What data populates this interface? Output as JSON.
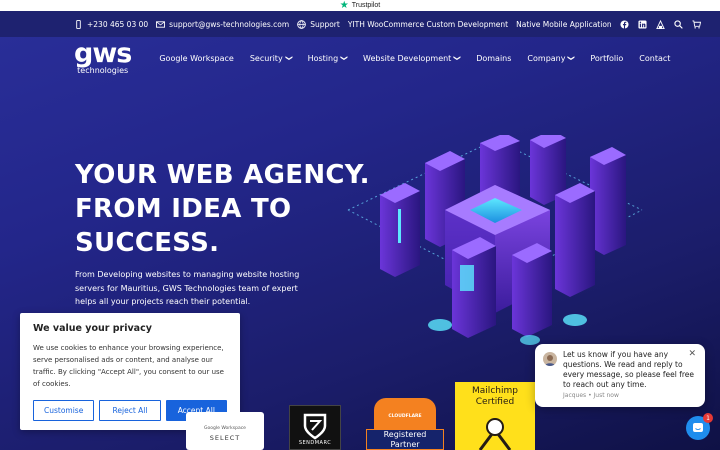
{
  "trustbar": {
    "label": "Trustpilot"
  },
  "topbar": {
    "phone": "+230 465 03 00",
    "email": "support@gws-technologies.com",
    "support": "Support",
    "yith": "YITH WooCommerce Custom Development",
    "mobile": "Native Mobile Application"
  },
  "logo": {
    "big": "gws",
    "small": "technologies"
  },
  "nav": {
    "items": [
      {
        "label": "Google Workspace",
        "chevron": false
      },
      {
        "label": "Security",
        "chevron": true
      },
      {
        "label": "Hosting",
        "chevron": true
      },
      {
        "label": "Website Development",
        "chevron": true
      },
      {
        "label": "Domains",
        "chevron": false
      },
      {
        "label": "Company",
        "chevron": true
      },
      {
        "label": "Portfolio",
        "chevron": false
      },
      {
        "label": "Contact",
        "chevron": false
      }
    ]
  },
  "hero": {
    "line1": "YOUR WEB AGENCY.",
    "line2": "FROM IDEA TO",
    "line3": "SUCCESS.",
    "subtitle": "From Developing websites to managing website hosting servers for Mauritius, GWS Technologies team of expert helps all your projects reach their potential."
  },
  "cookie": {
    "title": "We value your privacy",
    "body": "We use cookies to enhance your browsing experience, serve personalised ads or content, and analyse our traffic. By clicking \"Accept All\", you consent to our use of cookies.",
    "customise": "Customise",
    "reject": "Reject All",
    "accept": "Accept All"
  },
  "badges": {
    "google_small": "Google Workspace",
    "google_select": "SELECT",
    "sendmarc": "SENDMARC",
    "cloudflare": "CLOUDFLARE",
    "registered": "Registered",
    "partner": "Partner",
    "mailchimp1": "Mailchimp",
    "mailchimp2": "Certified"
  },
  "chat": {
    "message": "Let us know if you have any questions. We read and reply to every message, so please feel free to reach out any time.",
    "meta": "Jacques • Just now",
    "unread": "1"
  },
  "colors": {
    "accent": "#1863dc",
    "chat": "#1f8ded",
    "trustpilot": "#00b67a"
  }
}
